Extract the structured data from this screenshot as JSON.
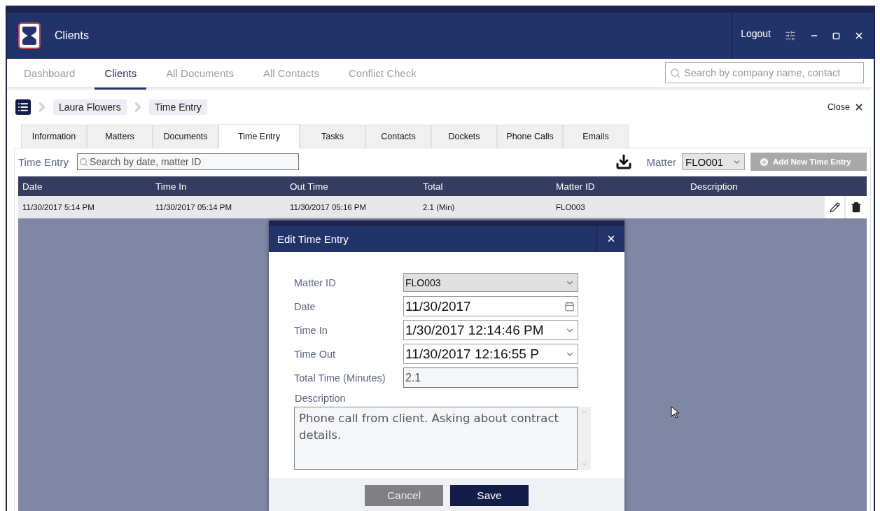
{
  "app": {
    "title": "Clients",
    "logout": "Logout"
  },
  "nav": {
    "tabs": [
      {
        "label": "Dashboard",
        "selected": false
      },
      {
        "label": "Clients",
        "selected": true
      },
      {
        "label": "All Documents",
        "selected": false
      },
      {
        "label": "All Contacts",
        "selected": false
      },
      {
        "label": "Conflict Check",
        "selected": false
      }
    ],
    "search": {
      "placeholder": "Search by company name, contact"
    }
  },
  "breadcrumb": [
    "Laura Flowers",
    "Time Entry"
  ],
  "close": "Close",
  "subtabs": [
    {
      "label": "Information",
      "selected": false
    },
    {
      "label": "Matters",
      "selected": false
    },
    {
      "label": "Documents",
      "selected": false
    },
    {
      "label": "Time Entry",
      "selected": true
    },
    {
      "label": "Tasks",
      "selected": false
    },
    {
      "label": "Contacts",
      "selected": false
    },
    {
      "label": "Dockets",
      "selected": false
    },
    {
      "label": "Phone Calls",
      "selected": false
    },
    {
      "label": "Emails",
      "selected": false
    }
  ],
  "toolbar": {
    "label": "Time Entry",
    "search": {
      "placeholder": "Search by date, matter ID"
    },
    "matter_label": "Matter",
    "matter_value": "FLO001",
    "add_button": {
      "label": "Add New Time Entry",
      "disabled": true
    }
  },
  "table": {
    "columns": [
      "Date",
      "Time In",
      "Out Time",
      "Total",
      "Matter ID",
      "Description"
    ],
    "rows": [
      {
        "cells": [
          "11/30/2017 5:14 PM",
          "11/30/2017 05:14 PM",
          "11/30/2017 05:16 PM",
          "2.1 (Min)",
          "FLO003"
        ]
      }
    ]
  },
  "dialog": {
    "title": "Edit Time Entry",
    "fields": [
      {
        "kind": "select",
        "label": "Matter ID",
        "value": "FLO003"
      },
      {
        "kind": "date",
        "label": "Date",
        "value": "11/30/2017"
      },
      {
        "kind": "datetime",
        "label": "Time In",
        "value": "1/30/2017 12:14:46 PM"
      },
      {
        "kind": "datetime",
        "label": "Time Out",
        "value": "11/30/2017 12:16:55 P"
      },
      {
        "kind": "readonly",
        "label": "Total Time (Minutes)",
        "value": "2.1"
      }
    ],
    "description": {
      "label": "Description",
      "value": "Phone call from client. Asking about contract details."
    },
    "buttons": [
      {
        "kind": "secondary",
        "label": "Cancel"
      },
      {
        "kind": "primary",
        "label": "Save"
      }
    ]
  }
}
